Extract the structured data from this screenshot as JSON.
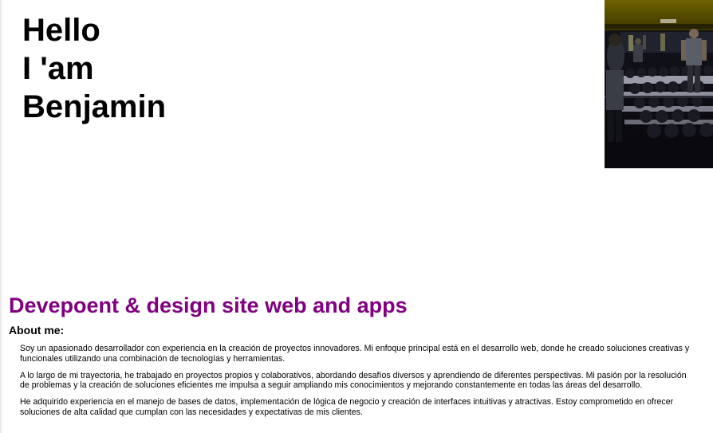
{
  "hero": {
    "line1": "Hello",
    "line2": "I 'am",
    "line3": "Benjamin"
  },
  "photo": {
    "name": "gym-photo"
  },
  "tagline": "Devepoent & design site web and apps",
  "about": {
    "heading": "About me:",
    "paragraphs": [
      "Soy un apasionado desarrollador con experiencia en la creación de proyectos innovadores. Mi enfoque principal está en el desarrollo web, donde he creado soluciones creativas y funcionales utilizando una combinación de tecnologías y herramientas.",
      "A lo largo de mi trayectoria, he trabajado en proyectos propios y colaborativos, abordando desafíos diversos y aprendiendo de diferentes perspectivas. Mi pasión por la resolución de problemas y la creación de soluciones eficientes me impulsa a seguir ampliando mis conocimientos y mejorando constantemente en todas las áreas del desarrollo.",
      "He adquirido experiencia en el manejo de bases de datos, implementación de lógica de negocio y creación de interfaces intuitivas y atractivas. Estoy comprometido en ofrecer soluciones de alta calidad que cumplan con las necesidades y expectativas de mis clientes."
    ]
  },
  "colors": {
    "tagline": "#800080",
    "text": "#000000",
    "background": "#ffffff"
  }
}
